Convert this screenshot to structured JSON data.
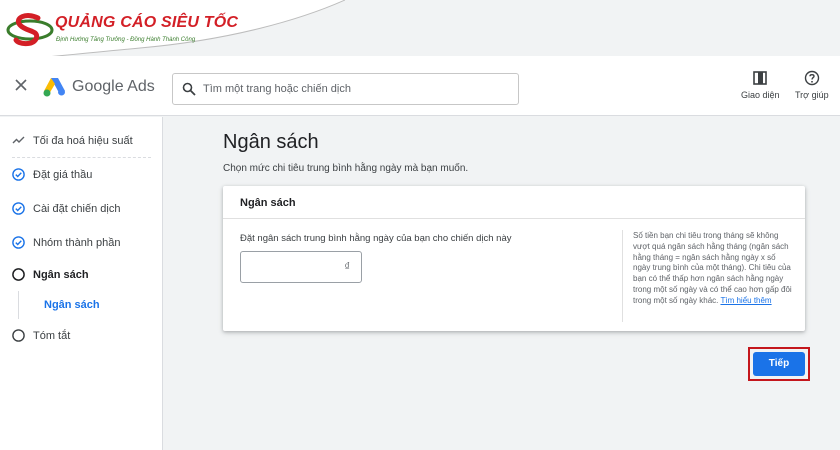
{
  "brand": {
    "name": "QUẢNG CÁO SIÊU TỐC",
    "tagline": "Định Hướng Tăng Trưởng - Đồng Hành Thành Công"
  },
  "header": {
    "product": "Google Ads",
    "search_placeholder": "Tìm một trang hoặc chiến dịch",
    "appearance_label": "Giao diện",
    "help_label": "Trợ giúp"
  },
  "sidebar": {
    "items": [
      {
        "label": "Tối đa hoá hiệu suất",
        "icon": "trend-icon"
      },
      {
        "label": "Đặt giá thầu",
        "icon": "check-circle-icon"
      },
      {
        "label": "Cài đặt chiến dịch",
        "icon": "check-circle-icon"
      },
      {
        "label": "Nhóm thành phần",
        "icon": "check-circle-icon"
      },
      {
        "label": "Ngân sách",
        "icon": "circle-icon"
      },
      {
        "label": "Tóm tắt",
        "icon": "circle-icon"
      }
    ],
    "sub_item": "Ngân sách"
  },
  "main": {
    "title": "Ngân sách",
    "subtitle": "Chọn mức chi tiêu trung bình hằng ngày mà bạn muốn.",
    "card_title": "Ngân sách",
    "budget_label": "Đặt ngân sách trung bình hằng ngày của bạn cho chiến dịch này",
    "currency": "₫",
    "help_text": "Số tiền bạn chi tiêu trong tháng sẽ không vượt quá ngân sách hằng tháng (ngân sách hằng tháng = ngân sách hằng ngày x số ngày trung bình của một tháng). Chi tiêu của bạn có thể thấp hơn ngân sách hằng ngày trong một số ngày và có thể cao hơn gấp đôi trong một số ngày khác.",
    "help_link": "Tìm hiểu thêm",
    "next_button": "Tiếp"
  },
  "colors": {
    "accent": "#1a73e8",
    "highlight": "#c4161c",
    "brand_red": "#d31f26",
    "brand_green": "#3a7d2c"
  }
}
